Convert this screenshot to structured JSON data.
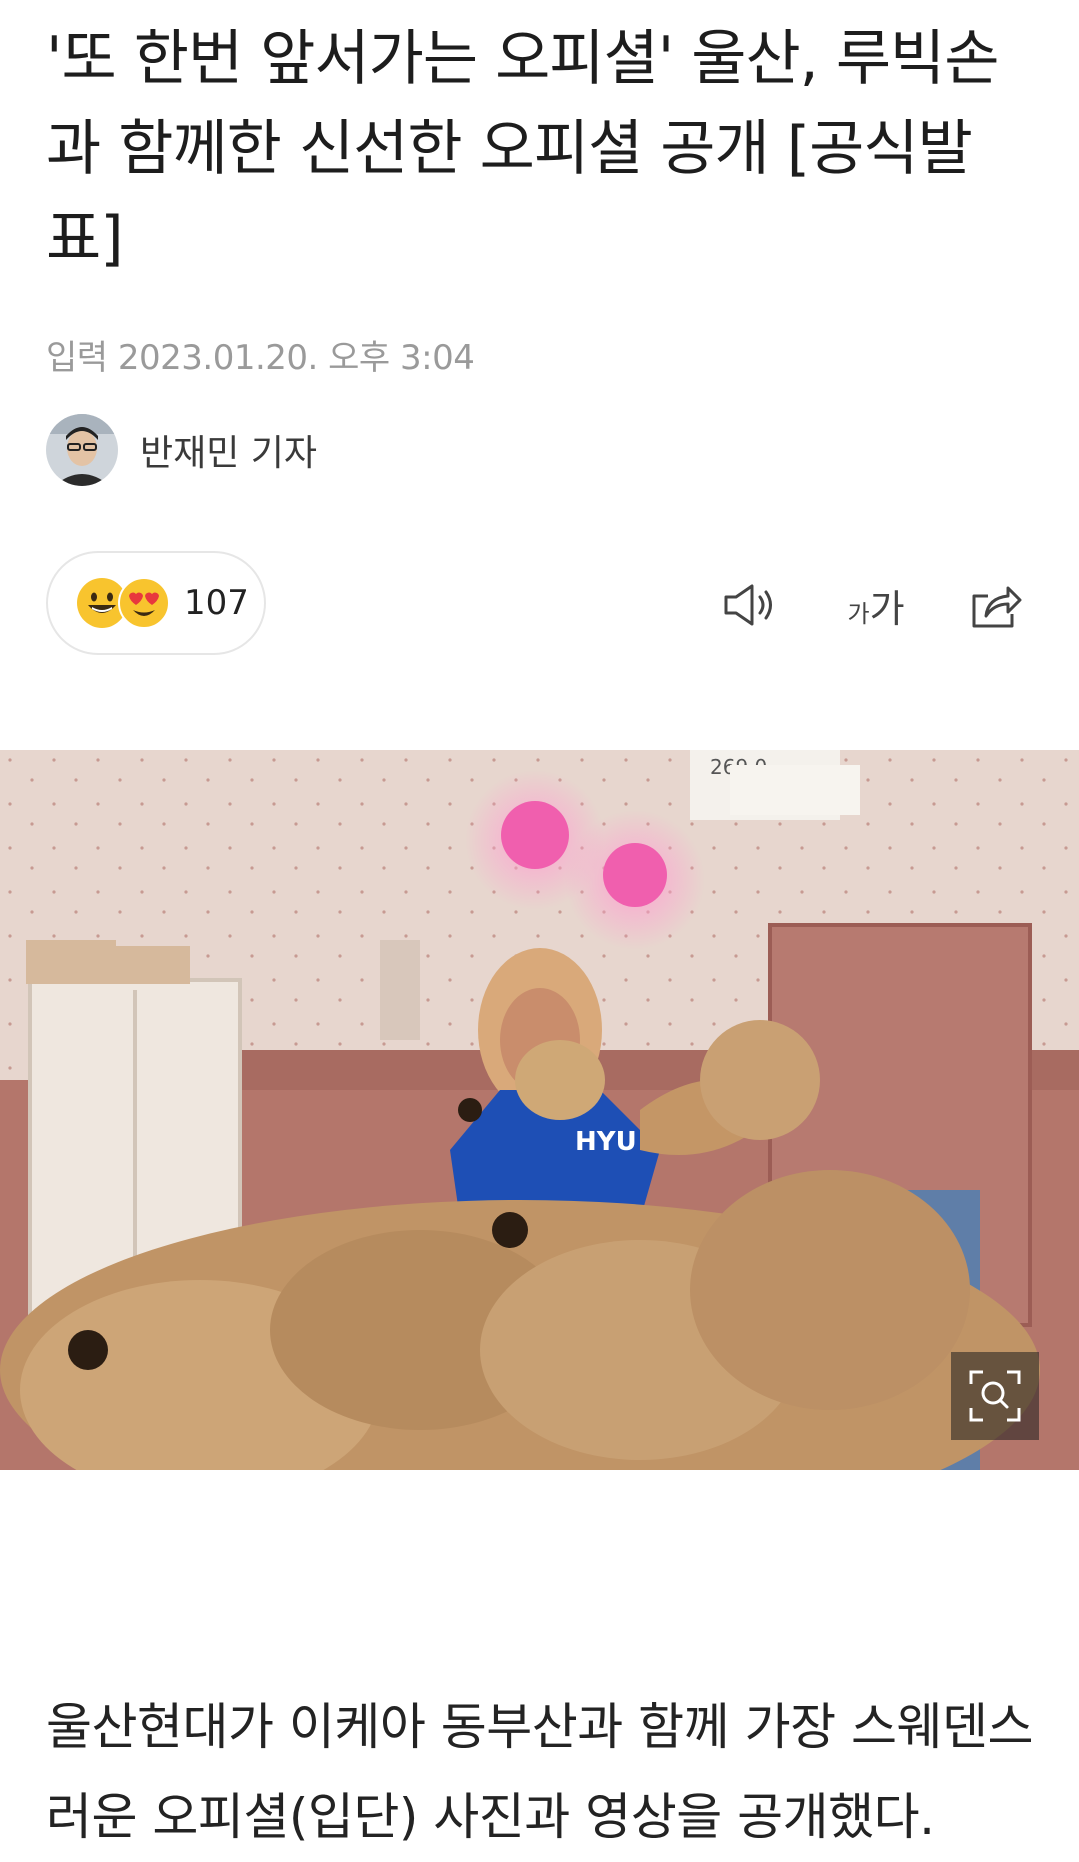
{
  "article": {
    "title": "'또 한번 앞서가는 오피셜' 울산, 루빅손과 함께한 신선한 오피셜 공개 [공식발표]",
    "date": "입력 2023.01.20. 오후 3:04",
    "author": "반재민 기자",
    "body": "울산현대가 이케아 동부산과 함께 가장 스웨덴스러운 오피셜(입단) 사진과 영상을 공개했다."
  },
  "reactions": {
    "count": "107",
    "icons": [
      "smile-emoji-icon",
      "heart-eyes-emoji-icon"
    ]
  },
  "toolbar": {
    "font_size_small": "가",
    "font_size_large": "가",
    "icons": [
      "speaker-icon",
      "font-size-icon",
      "share-icon"
    ]
  },
  "photo": {
    "price_tag": "269.0",
    "shirt_text": "HYU",
    "icons": [
      "zoom-icon"
    ]
  }
}
